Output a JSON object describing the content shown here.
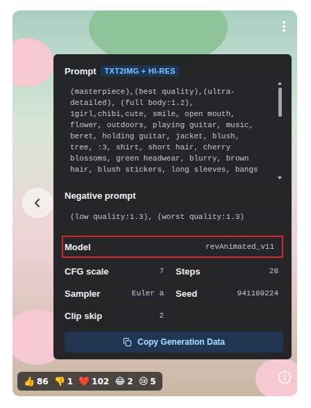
{
  "prompt": {
    "label": "Prompt",
    "badge": "TXT2IMG + HI-RES",
    "text": "(masterpiece),(best quality),(ultra-detailed), (full body:1.2), 1girl,chibi,cute, smile, open mouth, flower, outdoors, playing guitar, music, beret, holding guitar, jacket, blush, tree, :3, shirt, short hair, cherry blossoms, green headwear, blurry, brown hair, blush stickers, long sleeves, bangs"
  },
  "negative_prompt": {
    "label": "Negative prompt",
    "text": "(low quality:1.3), (worst quality:1.3)"
  },
  "settings": [
    {
      "label": "Model",
      "value": "revAnimated_v11",
      "kind": "wide",
      "highlighted": true
    },
    {
      "label": "CFG scale",
      "value": "7",
      "kind": "half",
      "highlighted": false
    },
    {
      "label": "Steps",
      "value": "28",
      "kind": "half",
      "highlighted": false
    },
    {
      "label": "Sampler",
      "value": "Euler a",
      "kind": "half",
      "highlighted": false
    },
    {
      "label": "Seed",
      "value": "941189224",
      "kind": "half",
      "highlighted": false
    },
    {
      "label": "Clip skip",
      "value": "2",
      "kind": "half",
      "highlighted": false
    }
  ],
  "button": {
    "label": "Copy Generation Data"
  },
  "reactions": [
    {
      "emoji": "👍",
      "count": "86"
    },
    {
      "emoji": "👎",
      "count": "1"
    },
    {
      "emoji": "❤️",
      "count": "102"
    },
    {
      "emoji": "😂",
      "count": "2"
    },
    {
      "emoji": "😢",
      "count": "5"
    }
  ]
}
